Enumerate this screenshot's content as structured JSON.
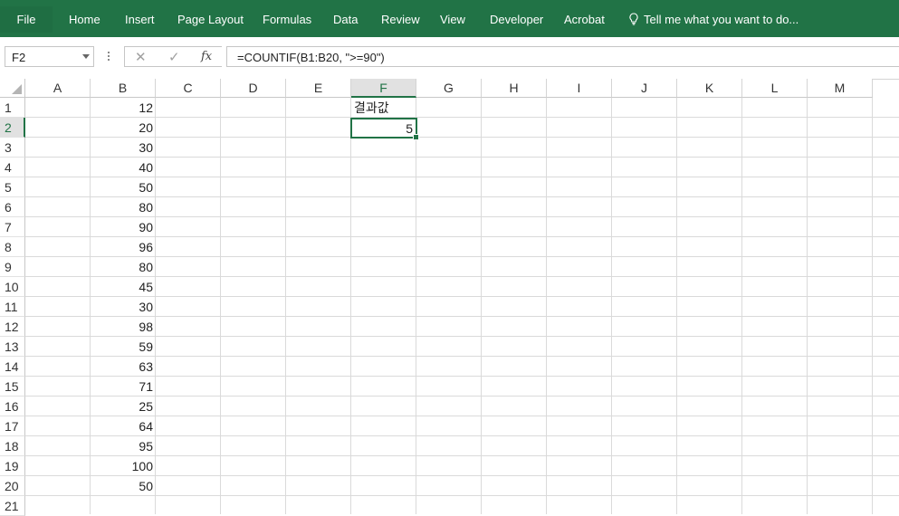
{
  "ribbon": {
    "tabs": [
      "File",
      "Home",
      "Insert",
      "Page Layout",
      "Formulas",
      "Data",
      "Review",
      "View",
      "Developer",
      "Acrobat"
    ],
    "tell_me": "Tell me what you want to do...",
    "color": "#217346"
  },
  "formula_bar": {
    "name_box": "F2",
    "cancel_icon": "✕",
    "enter_icon": "✓",
    "function_icon": "fx",
    "formula": "=COUNTIF(B1:B20, \">=90\")"
  },
  "sheet": {
    "columns": [
      "A",
      "B",
      "C",
      "D",
      "E",
      "F",
      "G",
      "H",
      "I",
      "J",
      "K",
      "L",
      "M"
    ],
    "rows": [
      "1",
      "2",
      "3",
      "4",
      "5",
      "6",
      "7",
      "8",
      "9",
      "10",
      "11",
      "12",
      "13",
      "14",
      "15",
      "16",
      "17",
      "18",
      "19",
      "20",
      "21"
    ],
    "selected_column": "F",
    "selected_row": "2",
    "column_b_values": [
      "12",
      "20",
      "30",
      "40",
      "50",
      "80",
      "90",
      "96",
      "80",
      "45",
      "30",
      "98",
      "59",
      "63",
      "71",
      "25",
      "64",
      "95",
      "100",
      "50"
    ],
    "f1_label": "결과값",
    "f2_value": "5"
  }
}
